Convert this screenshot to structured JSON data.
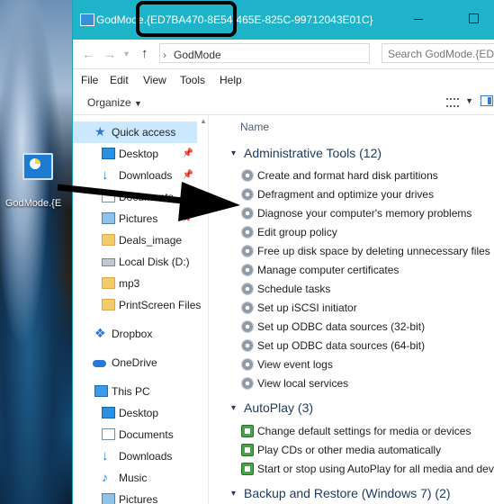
{
  "desktop": {
    "icon_label": "GodMode.{E"
  },
  "window": {
    "title": "GodMode.{ED7BA470-8E54-465E-825C-99712043E01C}",
    "breadcrumb": "GodMode",
    "search_placeholder": "Search GodMode.{ED...",
    "menu": [
      "File",
      "Edit",
      "View",
      "Tools",
      "Help"
    ],
    "organize": "Organize"
  },
  "sidebar": {
    "items": [
      {
        "label": "Quick access",
        "icon": "star-icon",
        "pinned": false
      },
      {
        "label": "Desktop",
        "icon": "desktop-icon",
        "pinned": true
      },
      {
        "label": "Downloads",
        "icon": "download-icon",
        "pinned": true
      },
      {
        "label": "Documents",
        "icon": "document-icon",
        "pinned": true
      },
      {
        "label": "Pictures",
        "icon": "pictures-icon",
        "pinned": true
      },
      {
        "label": "Deals_image",
        "icon": "folder-icon",
        "pinned": false
      },
      {
        "label": "Local Disk (D:)",
        "icon": "disk-icon",
        "pinned": false
      },
      {
        "label": "mp3",
        "icon": "folder-icon",
        "pinned": false
      },
      {
        "label": "PrintScreen Files",
        "icon": "folder-icon",
        "pinned": false
      },
      {
        "label": "Dropbox",
        "icon": "dropbox-icon",
        "pinned": false
      },
      {
        "label": "OneDrive",
        "icon": "onedrive-icon",
        "pinned": false
      },
      {
        "label": "This PC",
        "icon": "computer-icon",
        "pinned": false
      },
      {
        "label": "Desktop",
        "icon": "desktop-icon",
        "pinned": false
      },
      {
        "label": "Documents",
        "icon": "document-icon",
        "pinned": false
      },
      {
        "label": "Downloads",
        "icon": "download-icon",
        "pinned": false
      },
      {
        "label": "Music",
        "icon": "music-icon",
        "pinned": false
      },
      {
        "label": "Pictures",
        "icon": "pictures-icon",
        "pinned": false
      }
    ]
  },
  "content": {
    "column_name": "Name",
    "groups": [
      {
        "title": "Administrative Tools (12)",
        "items": [
          "Create and format hard disk partitions",
          "Defragment and optimize your drives",
          "Diagnose your computer's memory problems",
          "Edit group policy",
          "Free up disk space by deleting unnecessary files",
          "Manage computer certificates",
          "Schedule tasks",
          "Set up iSCSI initiator",
          "Set up ODBC data sources (32-bit)",
          "Set up ODBC data sources (64-bit)",
          "View event logs",
          "View local services"
        ]
      },
      {
        "title": "AutoPlay (3)",
        "items": [
          "Change default settings for media or devices",
          "Play CDs or other media automatically",
          "Start or stop using AutoPlay for all media and devices"
        ]
      },
      {
        "title": "Backup and Restore (Windows 7) (2)",
        "items": []
      }
    ]
  }
}
